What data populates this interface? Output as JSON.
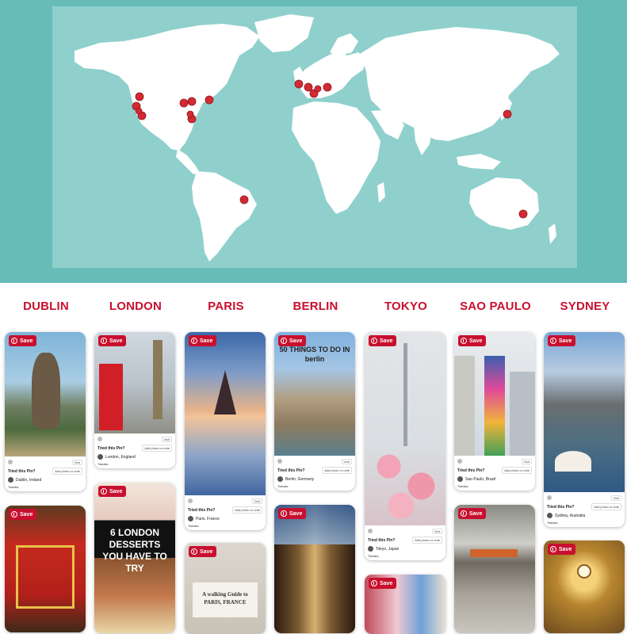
{
  "cities": [
    "DUBLIN",
    "LONDON",
    "PARIS",
    "BERLIN",
    "TOKYO",
    "SAO PAULO",
    "SYDNEY"
  ],
  "colors": {
    "brand_red": "#c8102e",
    "map_bg": "#67bcb8",
    "map_ocean": "#8fd0cc",
    "land": "#ffffff",
    "pin": "#d42a33"
  },
  "save_label": "Save",
  "tried_label": "Tried this Pin?",
  "add_label": "Add photo or note",
  "visit_label": "Visit",
  "tweaks_label": "Tweaks",
  "cards": {
    "dublin_1": {
      "location": "Dublin, Ireland"
    },
    "london_1": {
      "location": "London, England"
    },
    "london_2": {
      "title": "6 LONDON DESSERTS YOU HAVE TO TRY"
    },
    "paris_1": {
      "location": "Paris, France"
    },
    "paris_2": {
      "title": "A walking Guide to PARIS, FRANCE"
    },
    "berlin_1": {
      "title": "50 THINGS TO DO IN berlin",
      "location": "Berlin, Germany"
    },
    "tokyo_1": {
      "location": "Tokyo, Japan"
    },
    "saopaulo_1": {
      "location": "Sao Paulo, Brazil"
    },
    "sydney_1": {
      "location": "Sydney, Australia"
    }
  },
  "map_pins": [
    "san-francisco",
    "los-angeles",
    "seattle",
    "chicago",
    "toronto",
    "new-york",
    "washington",
    "atlanta",
    "dublin",
    "london",
    "paris",
    "amsterdam",
    "berlin",
    "tokyo",
    "sao-paulo",
    "sydney"
  ]
}
